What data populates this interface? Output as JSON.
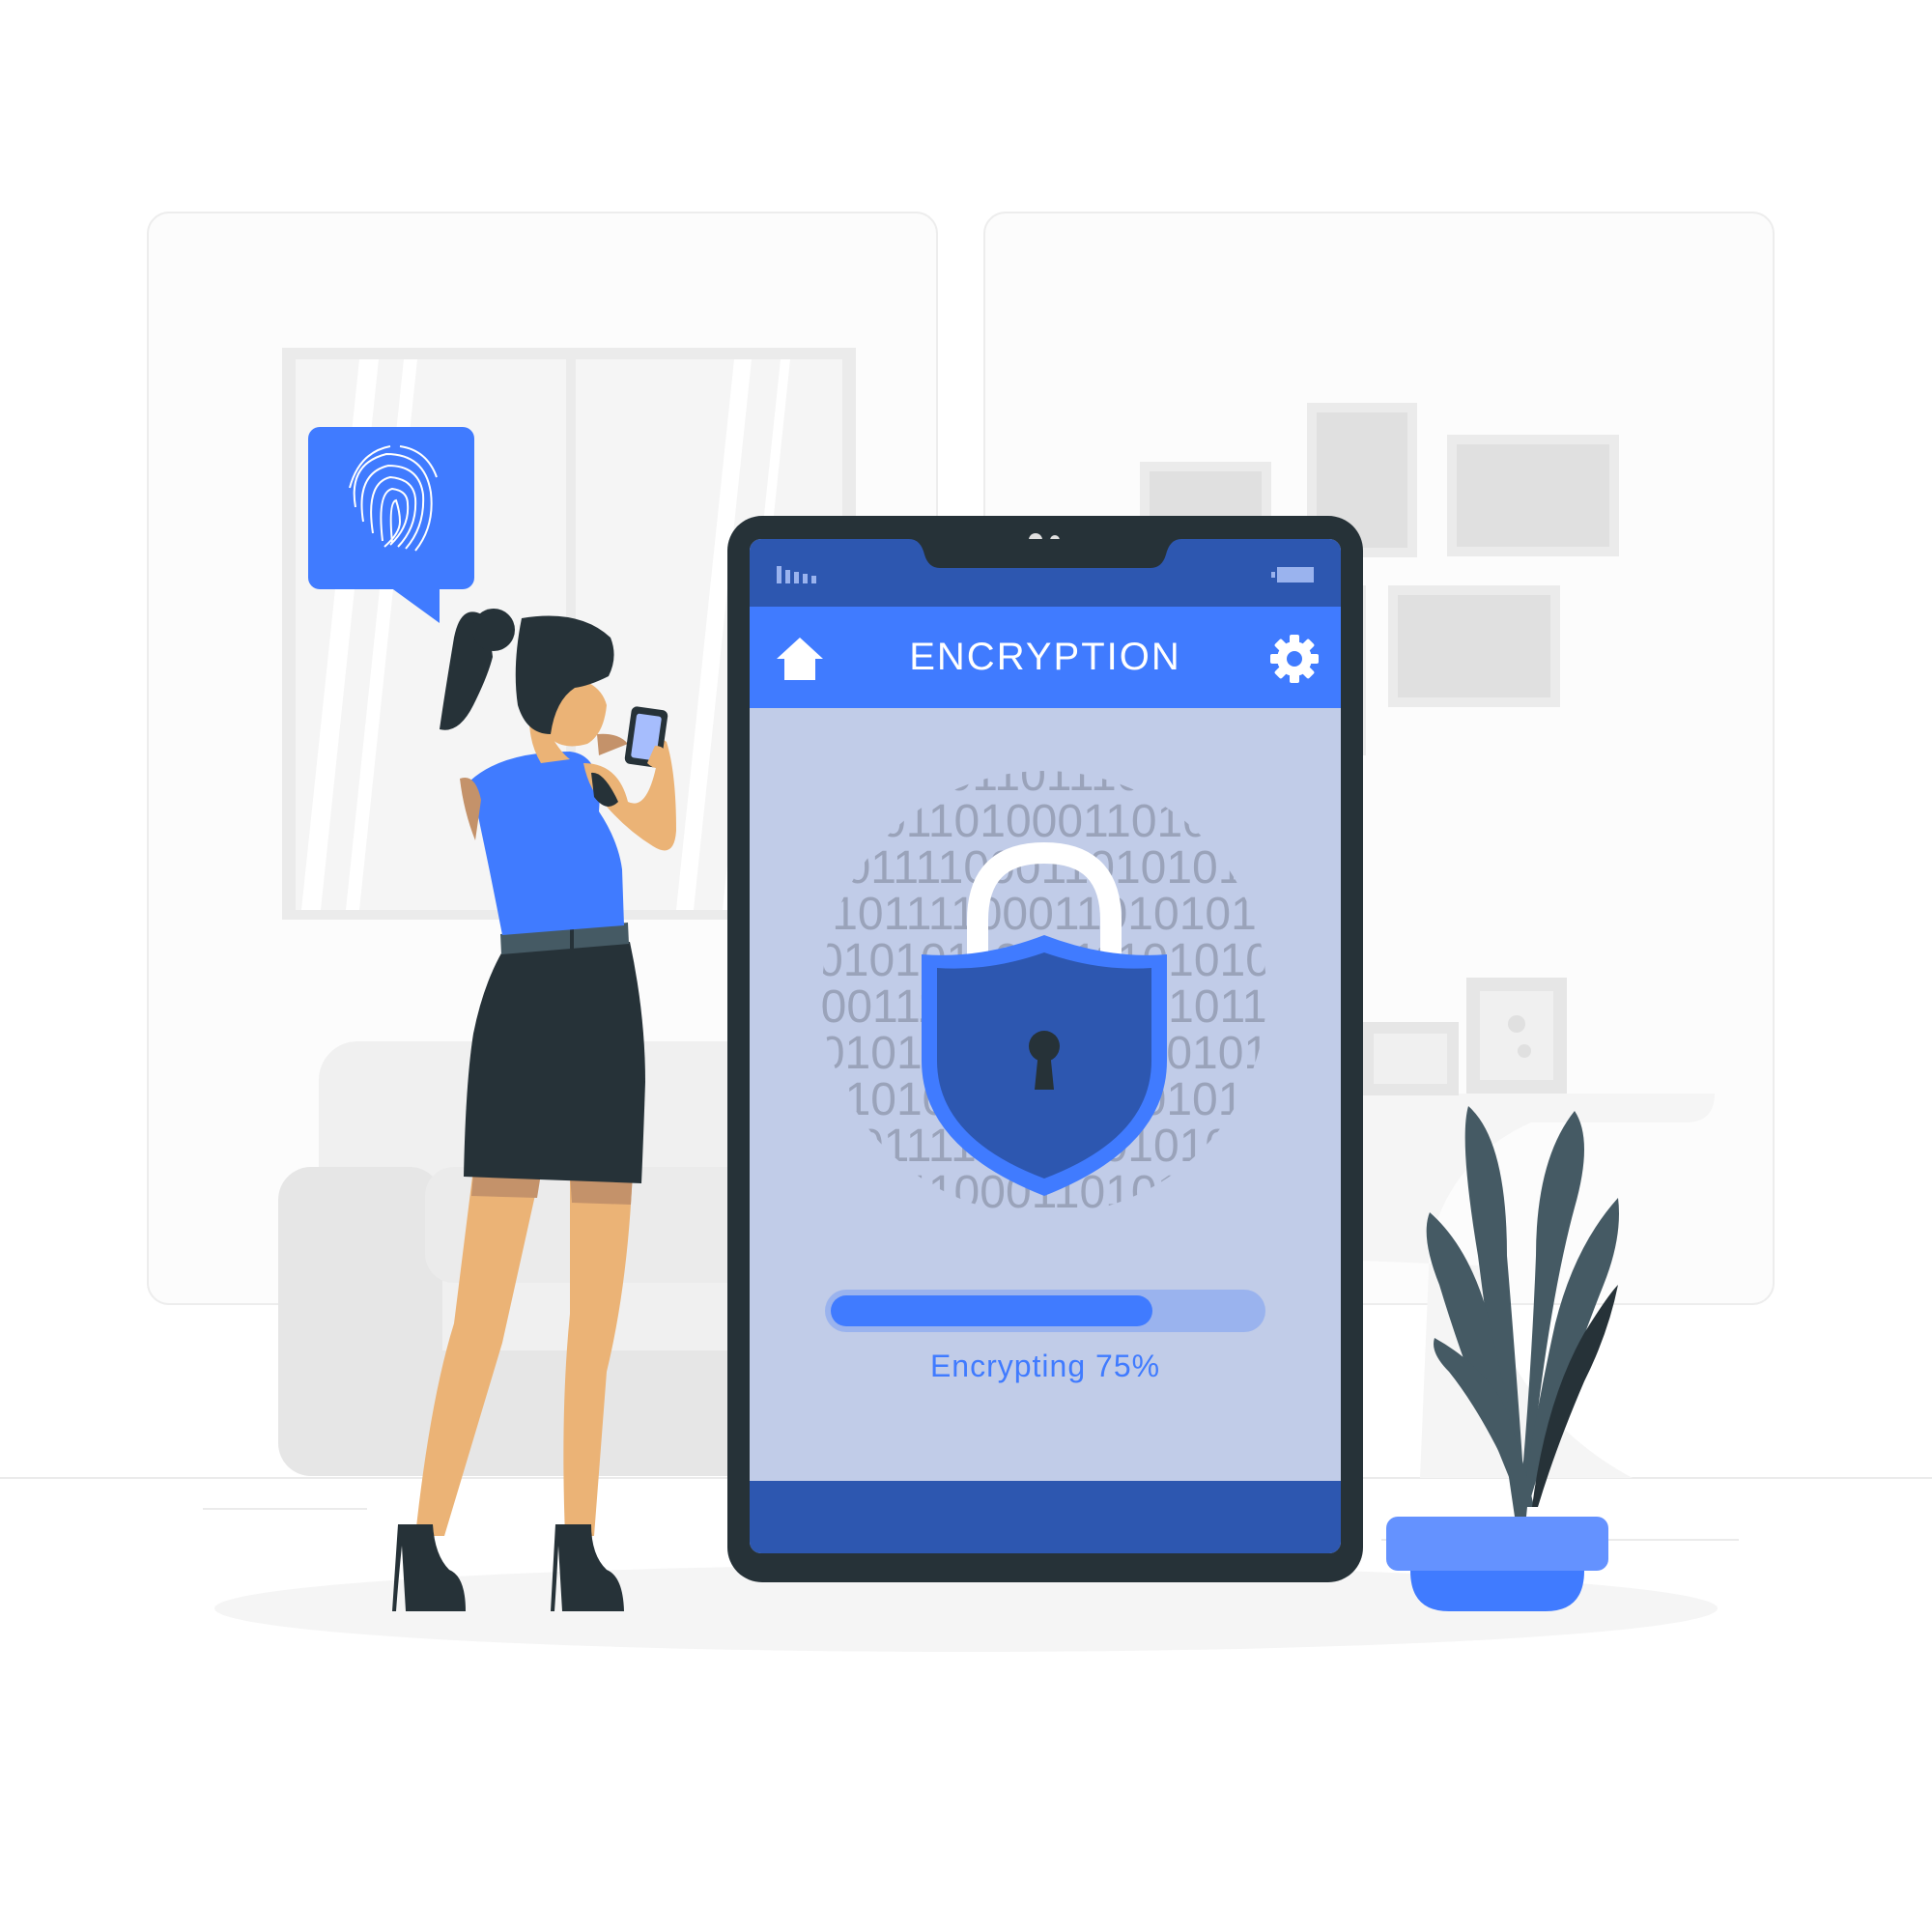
{
  "app": {
    "title": "ENCRYPTION"
  },
  "status_bar": {
    "signal_icon": "signal-icon",
    "battery_icon": "battery-icon"
  },
  "header": {
    "home_icon": "home-icon",
    "settings_icon": "gear-icon"
  },
  "encryption": {
    "lock_icon": "padlock-shield-icon",
    "progress_percent": 75,
    "progress_text": "Encrypting 75%"
  },
  "colors": {
    "accent": "#407bff",
    "dark_blue": "#2d57b0",
    "screen_bg": "#c1cce8",
    "phone_frame": "#263238",
    "progress_track": "#9ab3ee"
  },
  "illustration": {
    "speech_bubble_icon": "fingerprint-icon"
  }
}
